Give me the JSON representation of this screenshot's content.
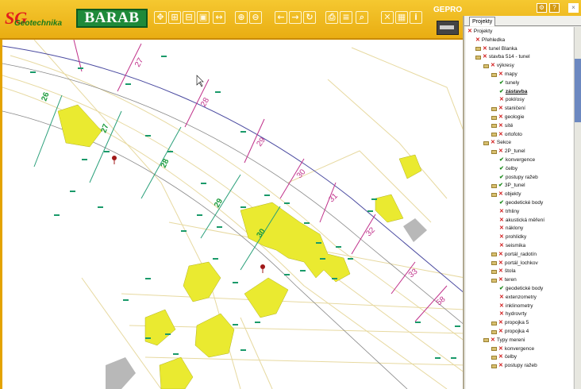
{
  "toolbar": {
    "logo_main": "SG",
    "logo_sub": "Geotechnika",
    "brand": "BARAB",
    "gepro": "GEPRO",
    "buttons": [
      {
        "name": "pan-icon",
        "glyph": "✥"
      },
      {
        "name": "zoom-in-area-icon",
        "glyph": "⊞"
      },
      {
        "name": "zoom-out-area-icon",
        "glyph": "⊟"
      },
      {
        "name": "zoom-window-icon",
        "glyph": "▣"
      },
      {
        "name": "measure-icon",
        "glyph": "↔"
      },
      {
        "name": "zoom-in-icon",
        "glyph": "⊕"
      },
      {
        "name": "zoom-out-icon",
        "glyph": "⊖"
      },
      {
        "name": "back-icon",
        "glyph": "←"
      },
      {
        "name": "forward-icon",
        "glyph": "→"
      },
      {
        "name": "refresh-icon",
        "glyph": "↻"
      },
      {
        "name": "print-icon",
        "glyph": "⎙"
      },
      {
        "name": "layers-icon",
        "glyph": "≡"
      },
      {
        "name": "search-icon",
        "glyph": "⌕"
      },
      {
        "name": "select-icon",
        "glyph": "✕"
      },
      {
        "name": "table-icon",
        "glyph": "▦"
      },
      {
        "name": "info-icon",
        "glyph": "i"
      }
    ]
  },
  "panel": {
    "tab": "Projekty",
    "tree": [
      {
        "label": "Projekty",
        "level": 0,
        "mark": "x",
        "folder": false
      },
      {
        "label": "Přehledka",
        "level": 1,
        "mark": "x",
        "folder": false
      },
      {
        "label": "tunel Blanka",
        "level": 1,
        "mark": "x",
        "folder": true
      },
      {
        "label": "stavba 514 - tunel",
        "level": 1,
        "mark": "x",
        "folder": true
      },
      {
        "label": "výkresy",
        "level": 2,
        "mark": "x",
        "folder": true
      },
      {
        "label": "mapy",
        "level": 3,
        "mark": "x",
        "folder": true
      },
      {
        "label": "tunely",
        "level": 4,
        "mark": "c",
        "folder": false
      },
      {
        "label": "zástavba",
        "level": 4,
        "mark": "c",
        "folder": false,
        "bold": true
      },
      {
        "label": "pokl/osy",
        "level": 4,
        "mark": "x",
        "folder": false
      },
      {
        "label": "staničení",
        "level": 3,
        "mark": "x",
        "folder": true
      },
      {
        "label": "geologie",
        "level": 3,
        "mark": "x",
        "folder": true
      },
      {
        "label": "sítě",
        "level": 3,
        "mark": "x",
        "folder": true
      },
      {
        "label": "ortofoto",
        "level": 3,
        "mark": "x",
        "folder": true
      },
      {
        "label": "Sekce",
        "level": 2,
        "mark": "x",
        "folder": true
      },
      {
        "label": "2P_tunel",
        "level": 3,
        "mark": "x",
        "folder": true
      },
      {
        "label": "konvergence",
        "level": 4,
        "mark": "c",
        "folder": false
      },
      {
        "label": "čelby",
        "level": 4,
        "mark": "c",
        "folder": false
      },
      {
        "label": "postupy ražeb",
        "level": 4,
        "mark": "c",
        "folder": false
      },
      {
        "label": "3P_tunel",
        "level": 3,
        "mark": "c",
        "folder": true
      },
      {
        "label": "objekty",
        "level": 3,
        "mark": "x",
        "folder": true
      },
      {
        "label": "geodetické body",
        "level": 4,
        "mark": "c",
        "folder": false
      },
      {
        "label": "trhliny",
        "level": 4,
        "mark": "x",
        "folder": false
      },
      {
        "label": "akustická měření",
        "level": 4,
        "mark": "x",
        "folder": false
      },
      {
        "label": "náklony",
        "level": 4,
        "mark": "x",
        "folder": false
      },
      {
        "label": "prohlídky",
        "level": 4,
        "mark": "x",
        "folder": false
      },
      {
        "label": "seismika",
        "level": 4,
        "mark": "x",
        "folder": false
      },
      {
        "label": "portál_radotín",
        "level": 3,
        "mark": "x",
        "folder": true
      },
      {
        "label": "portál_lochkov",
        "level": 3,
        "mark": "x",
        "folder": true
      },
      {
        "label": "štola",
        "level": 3,
        "mark": "x",
        "folder": true
      },
      {
        "label": "teren",
        "level": 3,
        "mark": "x",
        "folder": true
      },
      {
        "label": "geodetické body",
        "level": 4,
        "mark": "c",
        "folder": false
      },
      {
        "label": "extenzometry",
        "level": 4,
        "mark": "x",
        "folder": false
      },
      {
        "label": "inklinometry",
        "level": 4,
        "mark": "x",
        "folder": false
      },
      {
        "label": "hydrovrty",
        "level": 4,
        "mark": "x",
        "folder": false
      },
      {
        "label": "propojka 5",
        "level": 3,
        "mark": "x",
        "folder": true
      },
      {
        "label": "propojka 4",
        "level": 3,
        "mark": "x",
        "folder": true
      },
      {
        "label": "Typy mereni",
        "level": 2,
        "mark": "x",
        "folder": true
      },
      {
        "label": "konvergence",
        "level": 3,
        "mark": "x",
        "folder": true
      },
      {
        "label": "čelby",
        "level": 3,
        "mark": "x",
        "folder": true
      },
      {
        "label": "postupy ražeb",
        "level": 3,
        "mark": "x",
        "folder": true
      }
    ]
  },
  "map": {
    "stations_green": [
      "26",
      "27",
      "28",
      "29",
      "30"
    ],
    "stations_pink": [
      "27",
      "28",
      "29",
      "30",
      "31",
      "32",
      "33",
      "58"
    ]
  }
}
